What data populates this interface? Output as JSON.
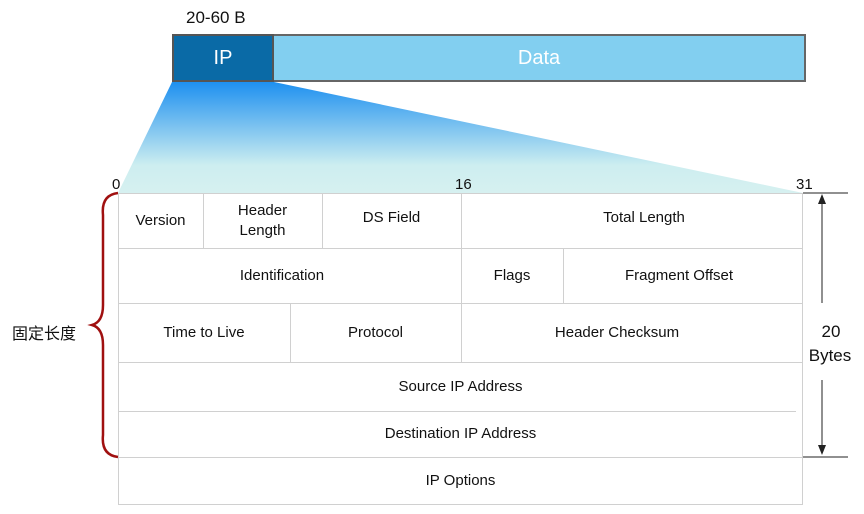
{
  "packet": {
    "size_label": "20-60 B",
    "ip_label": "IP",
    "data_label": "Data",
    "ip_color": "#0a6aa6",
    "data_color": "#82cff0"
  },
  "bits": {
    "start": "0",
    "mid": "16",
    "end": "31"
  },
  "rows": [
    [
      {
        "label": "Version"
      },
      {
        "label": "Header Length"
      },
      {
        "label": "DS Field"
      },
      {
        "label": "Total Length"
      }
    ],
    [
      {
        "label": "Identification"
      },
      {
        "label": "Flags"
      },
      {
        "label": "Fragment Offset"
      }
    ],
    [
      {
        "label": "Time to Live"
      },
      {
        "label": "Protocol"
      },
      {
        "label": "Header Checksum"
      }
    ],
    [
      {
        "label": "Source IP Address"
      }
    ],
    [
      {
        "label": "Destination IP Address"
      }
    ],
    [
      {
        "label": "IP  Options"
      }
    ]
  ],
  "fixed_length_label": "固定长度",
  "bytes_label": {
    "number": "20",
    "unit": "Bytes"
  },
  "brace_color": "#a01010"
}
